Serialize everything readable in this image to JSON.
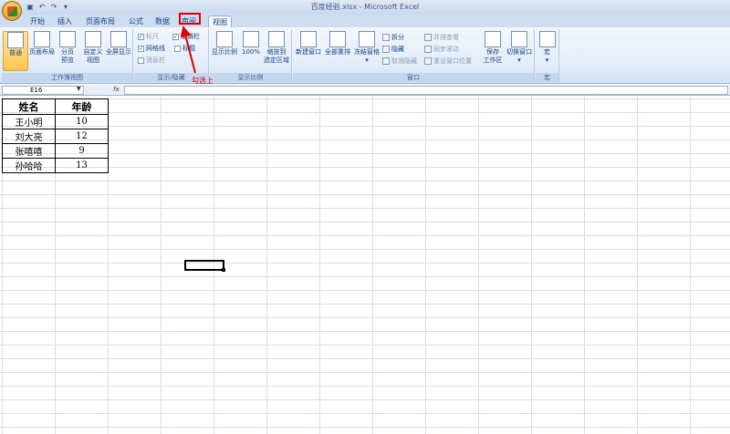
{
  "window": {
    "title": "百度经验.xlsx - Microsoft Excel"
  },
  "qat": {
    "save_icon": "save-icon",
    "undo_icon": "undo-icon",
    "redo_icon": "redo-icon"
  },
  "tabs": [
    "开始",
    "插入",
    "页面布局",
    "公式",
    "数据",
    "审阅",
    "视图"
  ],
  "active_tab": "视图",
  "ribbon": {
    "workbook_views": {
      "label": "工作簿视图",
      "buttons": [
        {
          "line1": "普通",
          "line2": ""
        },
        {
          "line1": "页面布局",
          "line2": ""
        },
        {
          "line1": "分页",
          "line2": "预览"
        },
        {
          "line1": "自定义",
          "line2": "视图"
        },
        {
          "line1": "全屏显示",
          "line2": ""
        }
      ]
    },
    "show_hide": {
      "label": "显示/隐藏",
      "ruler": "标尺",
      "gridlines": "网格线",
      "message_bar": "消息栏",
      "formula_bar": "编辑栏",
      "headings": "标题"
    },
    "zoom": {
      "label": "显示比例",
      "zoom": "显示比例",
      "hundred": "100%",
      "zoom_to_selection_line1": "缩放到",
      "zoom_to_selection_line2": "选定区域"
    },
    "window_group": {
      "label": "窗口",
      "new_window": "新建窗口",
      "arrange_all": "全部重排",
      "freeze_panes": "冻结窗格",
      "split": "拆分",
      "hide": "隐藏",
      "unhide": "取消隐藏",
      "view_side_by_side": "并排查看",
      "sync_scrolling": "同步滚动",
      "reset_position": "重设窗口位置",
      "save_workspace_line1": "保存",
      "save_workspace_line2": "工作区",
      "switch_windows": "切换窗口"
    },
    "macros": {
      "label": "宏",
      "button": "宏"
    }
  },
  "annotation": "勾选上",
  "formula_bar": {
    "name_box": "E16",
    "fx": "fx",
    "value": ""
  },
  "sheet": {
    "headers": [
      "姓名",
      "年龄"
    ],
    "rows": [
      [
        "王小明",
        "10"
      ],
      [
        "刘大亮",
        "12"
      ],
      [
        "张嘻嘻",
        "9"
      ],
      [
        "孙哈哈",
        "13"
      ]
    ]
  }
}
